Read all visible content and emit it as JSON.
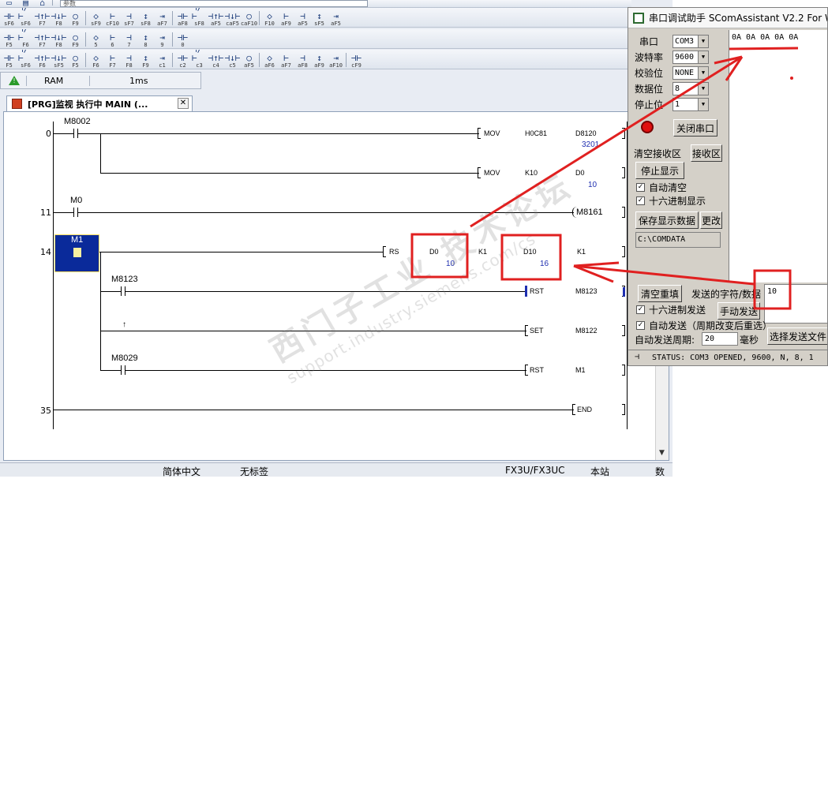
{
  "toolbar": {
    "combo_text": "参数",
    "row2": [
      "sF6",
      "sF6",
      "F7",
      "F8",
      "F9",
      "sF9",
      "cF10",
      "sF7",
      "sF8",
      "aF7",
      "aF8",
      "sF8",
      "aF5",
      "caF5",
      "caF10",
      "F10",
      "aF9",
      "aF5",
      "sF5",
      "aF5"
    ],
    "row3": [
      "F5",
      "F6",
      "F7",
      "F8",
      "F9",
      "5",
      "6",
      "7",
      "8",
      "9",
      "0"
    ],
    "row4": [
      "F5",
      "sF6",
      "F6",
      "sF5",
      "F5",
      "F6",
      "F7",
      "F8",
      "F9",
      "c1",
      "c2",
      "c3",
      "c4",
      "c5",
      "aF5",
      "aF6",
      "aF7",
      "aF8",
      "aF9",
      "aF10",
      "cF9"
    ]
  },
  "status_strip": {
    "memory": "RAM",
    "scan_time": "1ms"
  },
  "tab": {
    "label": "[PRG]监视 执行中 MAIN (...",
    "close": "✕"
  },
  "ladder": {
    "rungs": [
      {
        "step": "0",
        "contact": "M8002"
      },
      {
        "step": "11",
        "contact": "M0"
      },
      {
        "step": "14",
        "contact": "M1"
      },
      {
        "step": "35"
      }
    ],
    "instructions": {
      "mov1": {
        "op": "MOV",
        "src": "H0C81",
        "dst": "D8120",
        "dst_val": "3201"
      },
      "mov2": {
        "op": "MOV",
        "src": "K10",
        "dst": "D0",
        "dst_val": "10"
      },
      "coil_m8161": "M8161",
      "rs": {
        "op": "RS",
        "a": "D0",
        "a_val": "10",
        "b": "K1",
        "c": "D10",
        "c_val": "16",
        "d": "K1"
      },
      "rst1": {
        "contact": "M8123",
        "op": "RST",
        "dev": "M8123"
      },
      "set1": {
        "op": "SET",
        "dev": "M8122"
      },
      "rst2": {
        "contact": "M8029",
        "op": "RST",
        "dev": "M1"
      },
      "end": "END"
    }
  },
  "statusbar": {
    "lang": "简体中文",
    "label": "无标签",
    "plc": "FX3U/FX3UC",
    "station": "本站",
    "extra": "数"
  },
  "serial": {
    "title": "串口调试助手 SComAssistant V2.2 For W",
    "fields": [
      {
        "key": "串口",
        "value": "COM3"
      },
      {
        "key": "波特率",
        "value": "9600"
      },
      {
        "key": "校验位",
        "value": "NONE"
      },
      {
        "key": "数据位",
        "value": "8"
      },
      {
        "key": "停止位",
        "value": "1"
      }
    ],
    "close_port": "关闭串口",
    "clear_recv": "清空接收区",
    "recv_area": "接收区",
    "stop_display": "停止显示",
    "auto_clear": "自动清空",
    "hex_display": "十六进制显示",
    "save_data": "保存显示数据",
    "change": "更改",
    "path": "C:\\COMDATA",
    "received": "0A 0A 0A 0A 0A",
    "clear_refill": "清空重填",
    "send_label": "发送的字符/数据",
    "send_value": "10",
    "hex_send": "十六进制发送",
    "manual_send": "手动发送",
    "auto_send": "自动发送（周期改变后重选）",
    "auto_period_label": "自动发送周期:",
    "auto_period_value": "20",
    "ms": "毫秒",
    "choose_file": "选择发送文件",
    "status": "STATUS: COM3 OPENED, 9600, N, 8, 1"
  },
  "watermark": {
    "line1": "西门子工业 技术论坛",
    "line2": "support.industry.siemens.com/cs"
  },
  "colors": {
    "annotation": "#e02020",
    "monitor_value": "#1f2fb0",
    "cursor": "#0a2a9a"
  }
}
